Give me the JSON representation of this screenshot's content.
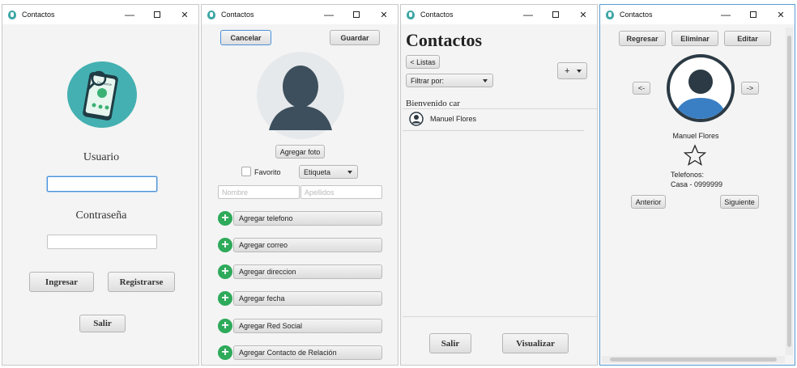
{
  "windows": {
    "login": {
      "title": "Contactos",
      "logo_screen_text": "Contactos",
      "user_label": "Usuario",
      "user_value": "",
      "password_label": "Contraseña",
      "password_value": "",
      "login_button": "Ingresar",
      "register_button": "Registrarse",
      "exit_button": "Salir"
    },
    "edit": {
      "title": "Contactos",
      "cancel_button": "Cancelar",
      "save_button": "Guardar",
      "add_photo_button": "Agregar foto",
      "favorite_label": "Favorito",
      "favorite_checked": false,
      "tag_select": "Etiqueta",
      "first_name_placeholder": "Nombre",
      "last_name_placeholder": "Apellidos",
      "add_actions": [
        "Agregar telefono",
        "Agregar correo",
        "Agregar direccion",
        "Agregar fecha",
        "Agregar Red Social",
        "Agregar Contacto de Relación"
      ]
    },
    "list": {
      "title": "Contactos",
      "heading": "Contactos",
      "lists_button": "< Listas",
      "add_button": "+",
      "filter_select": "Filtrar por:",
      "welcome_text": "Bienvenido car",
      "contacts": [
        {
          "name": "Manuel Flores"
        }
      ],
      "exit_button": "Salir",
      "view_button": "Visualizar"
    },
    "detail": {
      "title": "Contactos",
      "back_button": "Regresar",
      "delete_button": "Eliminar",
      "edit_button": "Editar",
      "prev_photo_button": "<-",
      "next_photo_button": "->",
      "contact_name": "Manuel Flores",
      "phones_label": "Telefonos:",
      "phone_entry": "Casa - 0999999",
      "previous_button": "Anterior",
      "next_button": "Siguiente"
    }
  },
  "window_controls": {
    "minimize": "—",
    "maximize": "",
    "close": "✕"
  },
  "colors": {
    "accent_green": "#2eaa5a",
    "logo_teal": "#44b0b1",
    "avatar_dark": "#3d4f5c",
    "avatar_blue": "#3a7fc4",
    "focus_blue": "#4a90d9"
  }
}
